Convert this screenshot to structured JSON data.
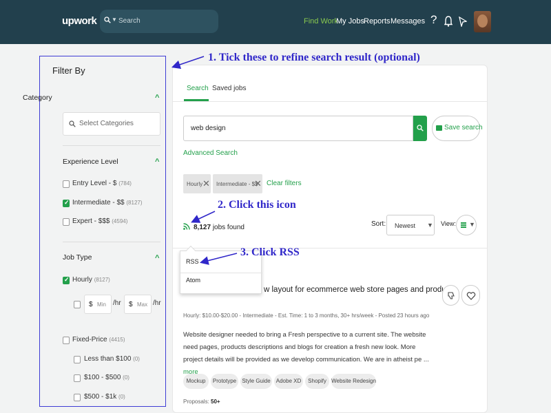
{
  "header": {
    "logo": "upwork",
    "search_placeholder": "Search",
    "nav": [
      "Find Work",
      "My Jobs",
      "Reports",
      "Messages"
    ],
    "icons": [
      "help-icon",
      "bell-icon",
      "send-icon",
      "avatar"
    ]
  },
  "sidebar": {
    "title": "Filter By",
    "category": {
      "label": "Category",
      "placeholder": "Select Categories"
    },
    "experience": {
      "label": "Experience Level",
      "items": [
        {
          "label": "Entry Level - $",
          "count": "(784)",
          "checked": false
        },
        {
          "label": "Intermediate - $$",
          "count": "(8127)",
          "checked": true
        },
        {
          "label": "Expert - $$$",
          "count": "(4594)",
          "checked": false
        }
      ]
    },
    "job_type": {
      "label": "Job Type",
      "hourly": {
        "label": "Hourly",
        "count": "(8127)",
        "checked": true
      },
      "min": "Min",
      "max": "Max",
      "per_hr": "/hr",
      "fixed": {
        "label": "Fixed-Price",
        "count": "(4415)",
        "checked": false
      },
      "ranges": [
        {
          "label": "Less than $100",
          "count": "(0)"
        },
        {
          "label": "$100 - $500",
          "count": "(0)"
        },
        {
          "label": "$500 - $1k",
          "count": "(0)"
        }
      ]
    }
  },
  "main": {
    "tabs": [
      "Search",
      "Saved jobs"
    ],
    "query": "web design",
    "save_search": "Save search",
    "advanced_search": "Advanced Search",
    "chips": [
      "Hourly",
      "Intermediate - $$"
    ],
    "clear_filters": "Clear filters",
    "jobs_found_count": "8,127",
    "jobs_found_text": "jobs found",
    "sort_label": "Sort:",
    "sort_value": "Newest",
    "view_label": "View:",
    "rss_menu": [
      "RSS",
      "Atom"
    ],
    "job": {
      "title": "w layout for ecommerce web store pages and products",
      "meta": "Hourly: $10.00-$20.00 - Intermediate - Est. Time: 1 to 3 months, 30+ hrs/week - Posted 23 hours ago",
      "description": "Website designer needed to bring a Fresh perspective to a current site. The website need pages, products descriptions and blogs for creation a fresh new look. More project details will be provided as we develop communication. We are in atheist pe ...",
      "more": "more",
      "tags": [
        "Mockup",
        "Prototype",
        "Style Guide",
        "Adobe XD",
        "Shopify",
        "Website Redesign"
      ],
      "proposals_label": "Proposals:",
      "proposals_value": "50+"
    }
  },
  "annotations": {
    "step1": "1. Tick these to refine search result (optional)",
    "step2": "2. Click this icon",
    "step3": "3. Click RSS"
  },
  "colors": {
    "header_bg": "#22404d",
    "accent_green": "#23a04b",
    "annotation_blue": "#3027c9"
  }
}
